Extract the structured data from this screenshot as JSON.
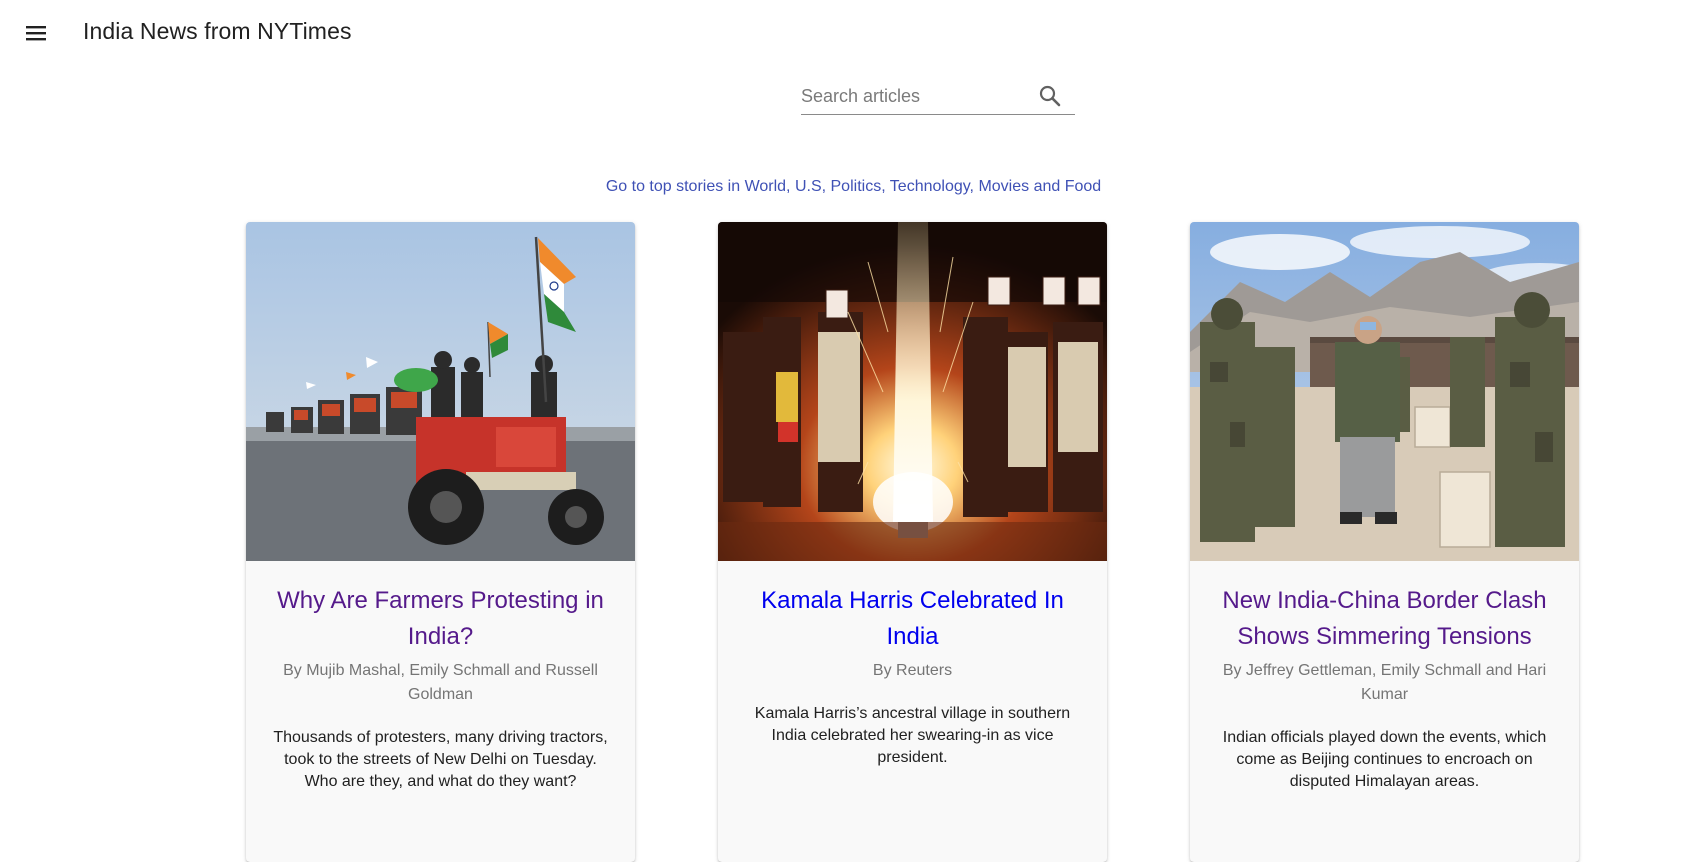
{
  "app": {
    "title": "India News from NYTimes"
  },
  "search": {
    "placeholder": "Search articles",
    "value": ""
  },
  "top_stories_link": "Go to top stories in World, U.S, Politics, Technology, Movies and Food",
  "articles": [
    {
      "title": "Why Are Farmers Protesting in India?",
      "byline": "By Mujib Mashal, Emily Schmall and Russell Goldman",
      "abstract": "Thousands of protesters, many driving tractors, took to the streets of New Delhi on Tuesday. Who are they, and what do they want?"
    },
    {
      "title": "Kamala Harris Celebrated In India",
      "byline": "By Reuters",
      "abstract": "Kamala Harris’s ancestral village in southern India celebrated her swearing-in as vice president."
    },
    {
      "title": "New India-China Border Clash Shows Simmering Tensions",
      "byline": "By Jeffrey Gettleman, Emily Schmall and Hari Kumar",
      "abstract": "Indian officials played down the events, which come as Beijing continues to encroach on disputed Himalayan areas."
    }
  ],
  "colors": {
    "link": "#3f51b5",
    "visited_title": "#551a8b",
    "unvisited_title": "#0000ee",
    "card_bg": "#f9f9f9"
  }
}
